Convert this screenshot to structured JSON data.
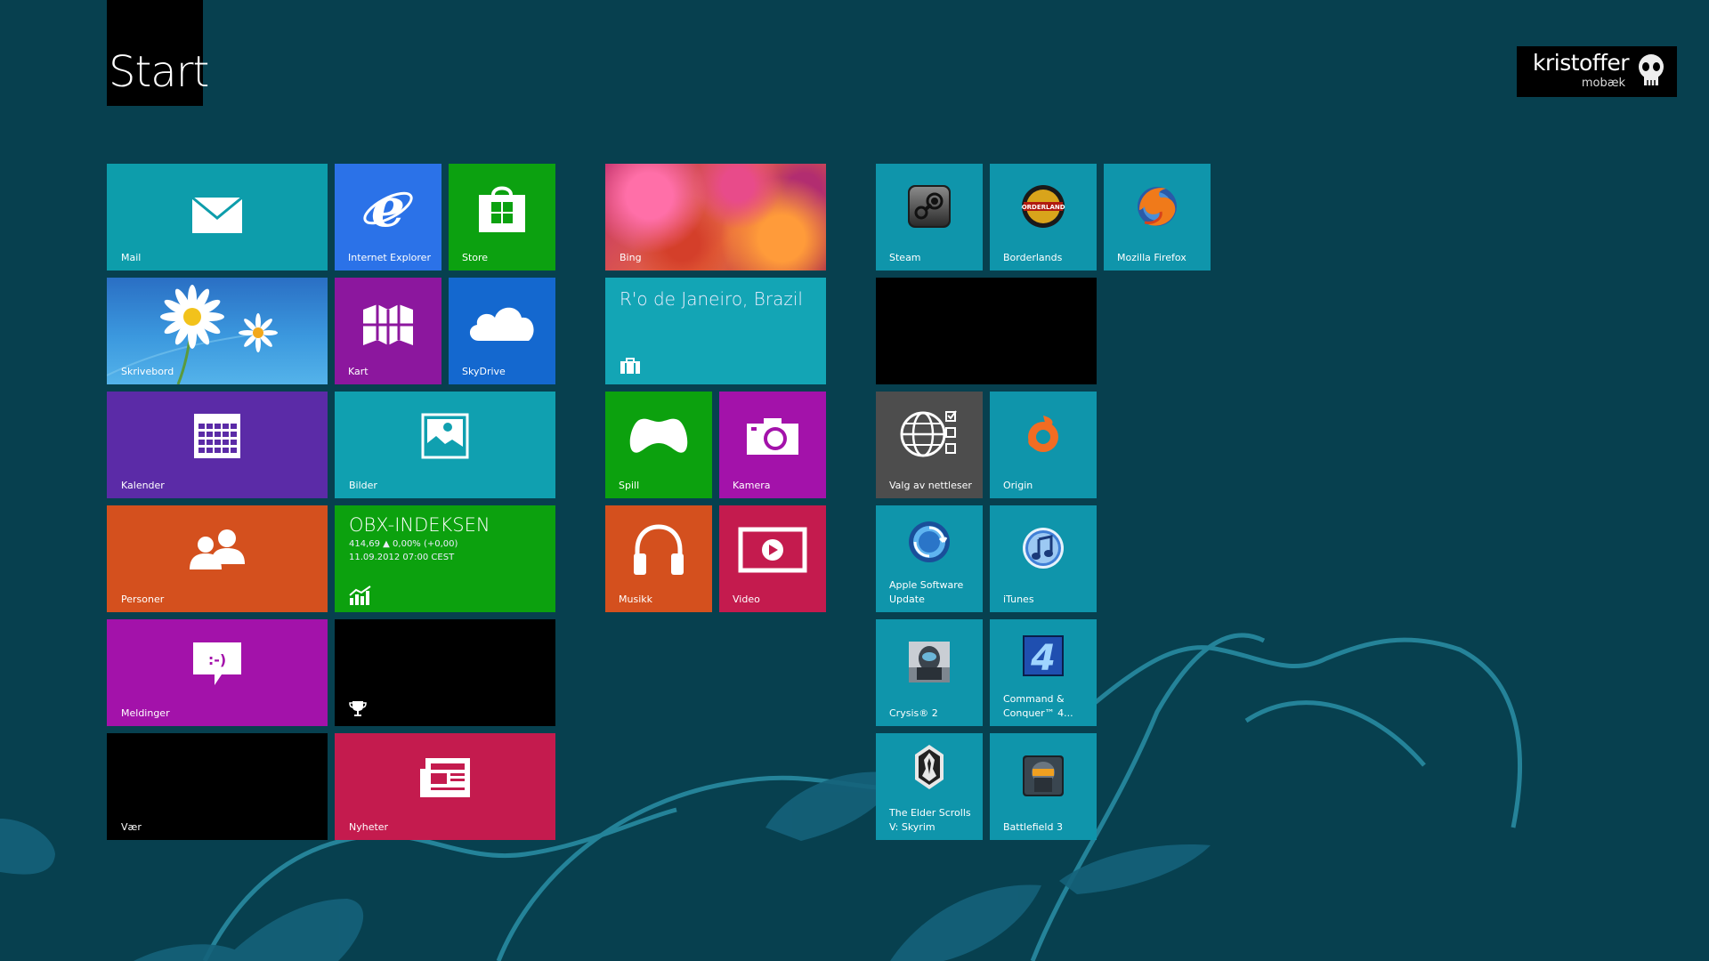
{
  "header": {
    "title": "Start"
  },
  "user": {
    "first_name": "kristoffer",
    "last_name": "mobæk"
  },
  "tiles": {
    "mail": {
      "label": "Mail",
      "icon": "mail-icon",
      "color": "#0d9dab"
    },
    "ie": {
      "label": "Internet Explorer",
      "icon": "internet-explorer-icon",
      "color": "#2b72e8"
    },
    "store": {
      "label": "Store",
      "icon": "store-icon",
      "color": "#0ca110"
    },
    "bing": {
      "label": "Bing",
      "color": "#c33b71"
    },
    "steam": {
      "label": "Steam",
      "icon": "steam-icon",
      "color": "#0f95ab"
    },
    "borderlands": {
      "label": "Borderlands",
      "icon": "borderlands-icon",
      "color": "#0f95ab"
    },
    "firefox": {
      "label": "Mozilla Firefox",
      "icon": "firefox-icon",
      "color": "#0f95ab"
    },
    "desktop": {
      "label": "Skrivebord",
      "color": "#3a8ed8"
    },
    "maps": {
      "label": "Kart",
      "icon": "maps-icon",
      "color": "#8c179e"
    },
    "skydrive": {
      "label": "SkyDrive",
      "icon": "cloud-icon",
      "color": "#1468cf"
    },
    "travel": {
      "title": "R'o de Janeiro, Brazil",
      "icon": "suitcase-icon",
      "color": "#13a5b5"
    },
    "blank1": {
      "color": "#000000"
    },
    "calendar": {
      "label": "Kalender",
      "icon": "calendar-icon",
      "color": "#5b2ba7"
    },
    "photos": {
      "label": "Bilder",
      "icon": "photos-icon",
      "color": "#10a0b0"
    },
    "games": {
      "label": "Spill",
      "icon": "gamepad-icon",
      "color": "#0ca10e"
    },
    "camera": {
      "label": "Kamera",
      "icon": "camera-icon",
      "color": "#a312aa"
    },
    "browser_choice": {
      "label": "Valg av nettleser",
      "icon": "browser-choice-icon",
      "color": "#4d4d4d"
    },
    "origin": {
      "label": "Origin",
      "icon": "origin-icon",
      "color": "#0f95ab"
    },
    "people": {
      "label": "Personer",
      "icon": "people-icon",
      "color": "#d4501e"
    },
    "finance": {
      "title": "OBX-INDEKSEN",
      "line1": "414,69 ▲ 0,00% (+0,00)",
      "line2": "11.09.2012 07:00 CEST",
      "icon": "chart-icon",
      "color": "#0ca10e"
    },
    "music": {
      "label": "Musikk",
      "icon": "headphones-icon",
      "color": "#d4501e"
    },
    "video": {
      "label": "Video",
      "icon": "video-icon",
      "color": "#c41b4e"
    },
    "apple_update": {
      "label": "Apple Software Update",
      "icon": "apple-update-icon",
      "color": "#0f95ab"
    },
    "itunes": {
      "label": "iTunes",
      "icon": "itunes-icon",
      "color": "#0f95ab"
    },
    "messaging": {
      "label": "Meldinger",
      "icon": "messaging-icon",
      "color": "#a312aa"
    },
    "xbox_games": {
      "icon": "trophy-icon",
      "color": "#000000"
    },
    "crysis": {
      "label": "Crysis® 2",
      "icon": "crysis-icon",
      "color": "#0f95ab"
    },
    "command_conquer": {
      "label": "Command & Conquer™ 4...",
      "icon": "command-conquer-icon",
      "color": "#0f95ab"
    },
    "weather": {
      "label": "Vær",
      "color": "#000000"
    },
    "news": {
      "label": "Nyheter",
      "icon": "news-icon",
      "color": "#c41b4e"
    },
    "skyrim": {
      "label": "The Elder Scrolls V: Skyrim",
      "icon": "skyrim-icon",
      "color": "#0f95ab"
    },
    "bf3": {
      "label": "Battlefield 3",
      "icon": "battlefield-icon",
      "color": "#0f95ab"
    }
  }
}
